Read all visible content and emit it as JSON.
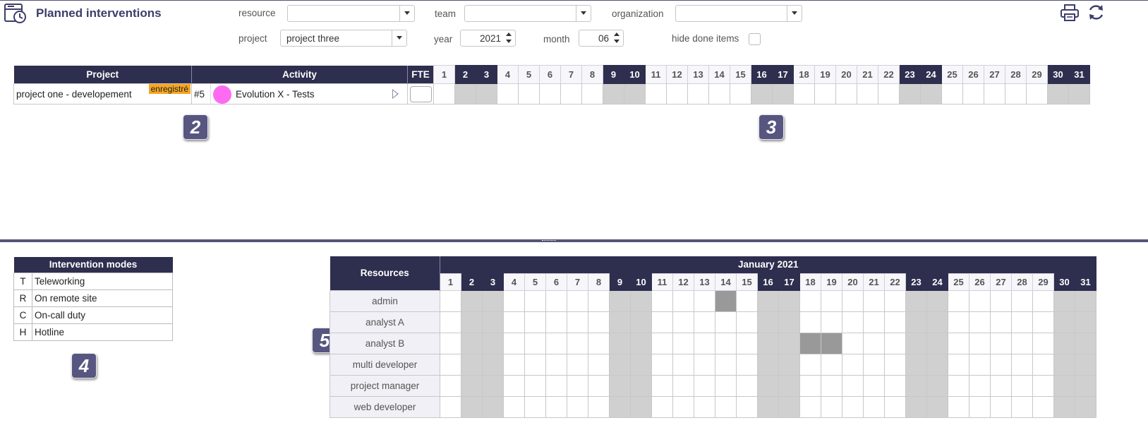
{
  "header": {
    "title": "Planned interventions",
    "filters": {
      "resource_label": "resource",
      "resource_value": "",
      "team_label": "team",
      "team_value": "",
      "organization_label": "organization",
      "organization_value": "",
      "project_label": "project",
      "project_value": "project three",
      "year_label": "year",
      "year_value": "2021",
      "month_label": "month",
      "month_value": "06",
      "hide_done_label": "hide done items",
      "hide_done_checked": false
    },
    "icons": [
      "printer-icon",
      "refresh-icon"
    ]
  },
  "planning": {
    "columns": {
      "project": "Project",
      "activity": "Activity",
      "fte": "FTE"
    },
    "days": [
      "1",
      "2",
      "3",
      "4",
      "5",
      "6",
      "7",
      "8",
      "9",
      "10",
      "11",
      "12",
      "13",
      "14",
      "15",
      "16",
      "17",
      "18",
      "19",
      "20",
      "21",
      "22",
      "23",
      "24",
      "25",
      "26",
      "27",
      "28",
      "29",
      "30",
      "31"
    ],
    "weekend_days": [
      2,
      3,
      9,
      10,
      16,
      17,
      23,
      24,
      30,
      31
    ],
    "rows": [
      {
        "project": "project one - developement",
        "tag": "enregistré",
        "activity_id": "#5",
        "activity_name": "Evolution X - Tests",
        "activity_color": "#ff6bf0",
        "fte": ""
      }
    ]
  },
  "callouts": {
    "c2": "2",
    "c3": "3",
    "c4": "4",
    "c5": "5"
  },
  "modes": {
    "title": "Intervention modes",
    "items": [
      {
        "code": "T",
        "label": "Teleworking"
      },
      {
        "code": "R",
        "label": "On remote site"
      },
      {
        "code": "C",
        "label": "On-call duty"
      },
      {
        "code": "H",
        "label": "Hotline"
      }
    ]
  },
  "resources": {
    "header": "Resources",
    "month_title": "January 2021",
    "days": [
      "1",
      "2",
      "3",
      "4",
      "5",
      "6",
      "7",
      "8",
      "9",
      "10",
      "11",
      "12",
      "13",
      "14",
      "15",
      "16",
      "17",
      "18",
      "19",
      "20",
      "21",
      "22",
      "23",
      "24",
      "25",
      "26",
      "27",
      "28",
      "29",
      "30",
      "31"
    ],
    "weekend_days": [
      2,
      3,
      9,
      10,
      16,
      17,
      23,
      24,
      30,
      31
    ],
    "rows": [
      {
        "name": "admin",
        "busy_days": [
          14
        ]
      },
      {
        "name": "analyst A",
        "busy_days": []
      },
      {
        "name": "analyst B",
        "busy_days": [
          18,
          19
        ]
      },
      {
        "name": "multi developer",
        "busy_days": []
      },
      {
        "name": "project manager",
        "busy_days": []
      },
      {
        "name": "web developer",
        "busy_days": []
      }
    ]
  },
  "colors": {
    "header_bg": "#2e2e4f",
    "weekend_cell": "#d0d0d0",
    "busy_cell": "#999999",
    "tag_bg": "#f5a623",
    "accent": "#545478"
  }
}
